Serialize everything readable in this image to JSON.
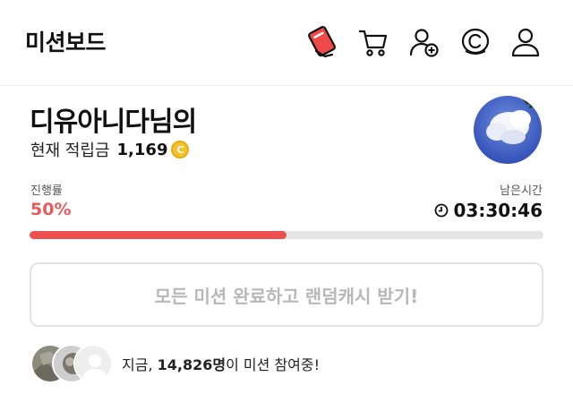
{
  "header": {
    "title": "미션보드",
    "icons": [
      "mission-card-icon",
      "cart-icon",
      "add-friend-icon",
      "coin-c-icon",
      "profile-icon"
    ]
  },
  "user": {
    "nickname": "디유아니다님의",
    "points_label": "현재 적립금",
    "points_value": "1,169",
    "coin_symbol": "C"
  },
  "progress": {
    "label": "진행률",
    "value_text": "50%",
    "fraction": 0.5
  },
  "timer": {
    "label": "남은시간",
    "value": "03:30:46"
  },
  "reward_button": {
    "label": "모든 미션 완료하고 랜덤캐시 받기!"
  },
  "participants": {
    "prefix": "지금,",
    "count": "14,826명",
    "suffix": "이 미션 참여중!"
  },
  "colors": {
    "accent": "#ef4f4f",
    "progress_text": "#e65c5c",
    "coin": "#f3c22e",
    "disabled_text": "#b8b8b8"
  }
}
